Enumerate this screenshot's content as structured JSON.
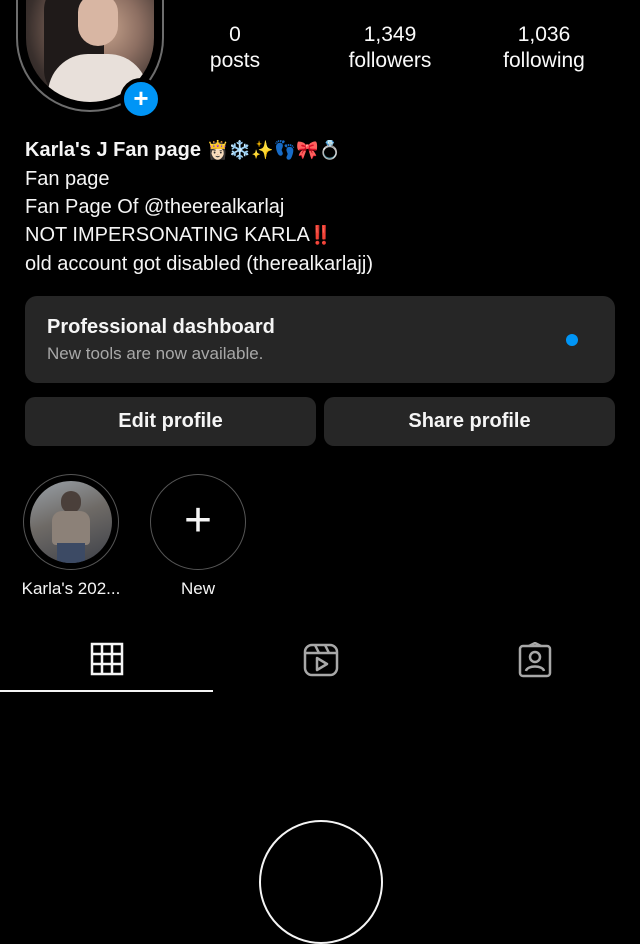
{
  "profile": {
    "stats": {
      "posts": {
        "value": "0",
        "label": "posts"
      },
      "followers": {
        "value": "1,349",
        "label": "followers"
      },
      "following": {
        "value": "1,036",
        "label": "following"
      }
    },
    "name": "Karla's J Fan page",
    "name_emojis": "👸🏻❄️✨👣🎀💍",
    "bio_lines": [
      "Fan page",
      "Fan Page Of @theerealkarlaj",
      "NOT IMPERSONATING KARLA",
      "old account got disabled  (therealkarlajj)"
    ],
    "bio_line3_emoji": "‼️"
  },
  "dashboard": {
    "title": "Professional dashboard",
    "subtitle": "New tools are now available."
  },
  "buttons": {
    "edit": "Edit profile",
    "share": "Share profile"
  },
  "highlights": [
    {
      "label": "Karla's 202..."
    },
    {
      "label": "New"
    }
  ],
  "tabs": [
    "grid",
    "reels",
    "tagged"
  ],
  "colors": {
    "background": "#000000",
    "card": "#262626",
    "accent": "#0095f6",
    "text": "#f5f5f5",
    "muted": "#a8a8a8"
  },
  "icons": [
    "plus-icon",
    "grid-icon",
    "reels-icon",
    "tagged-icon"
  ]
}
